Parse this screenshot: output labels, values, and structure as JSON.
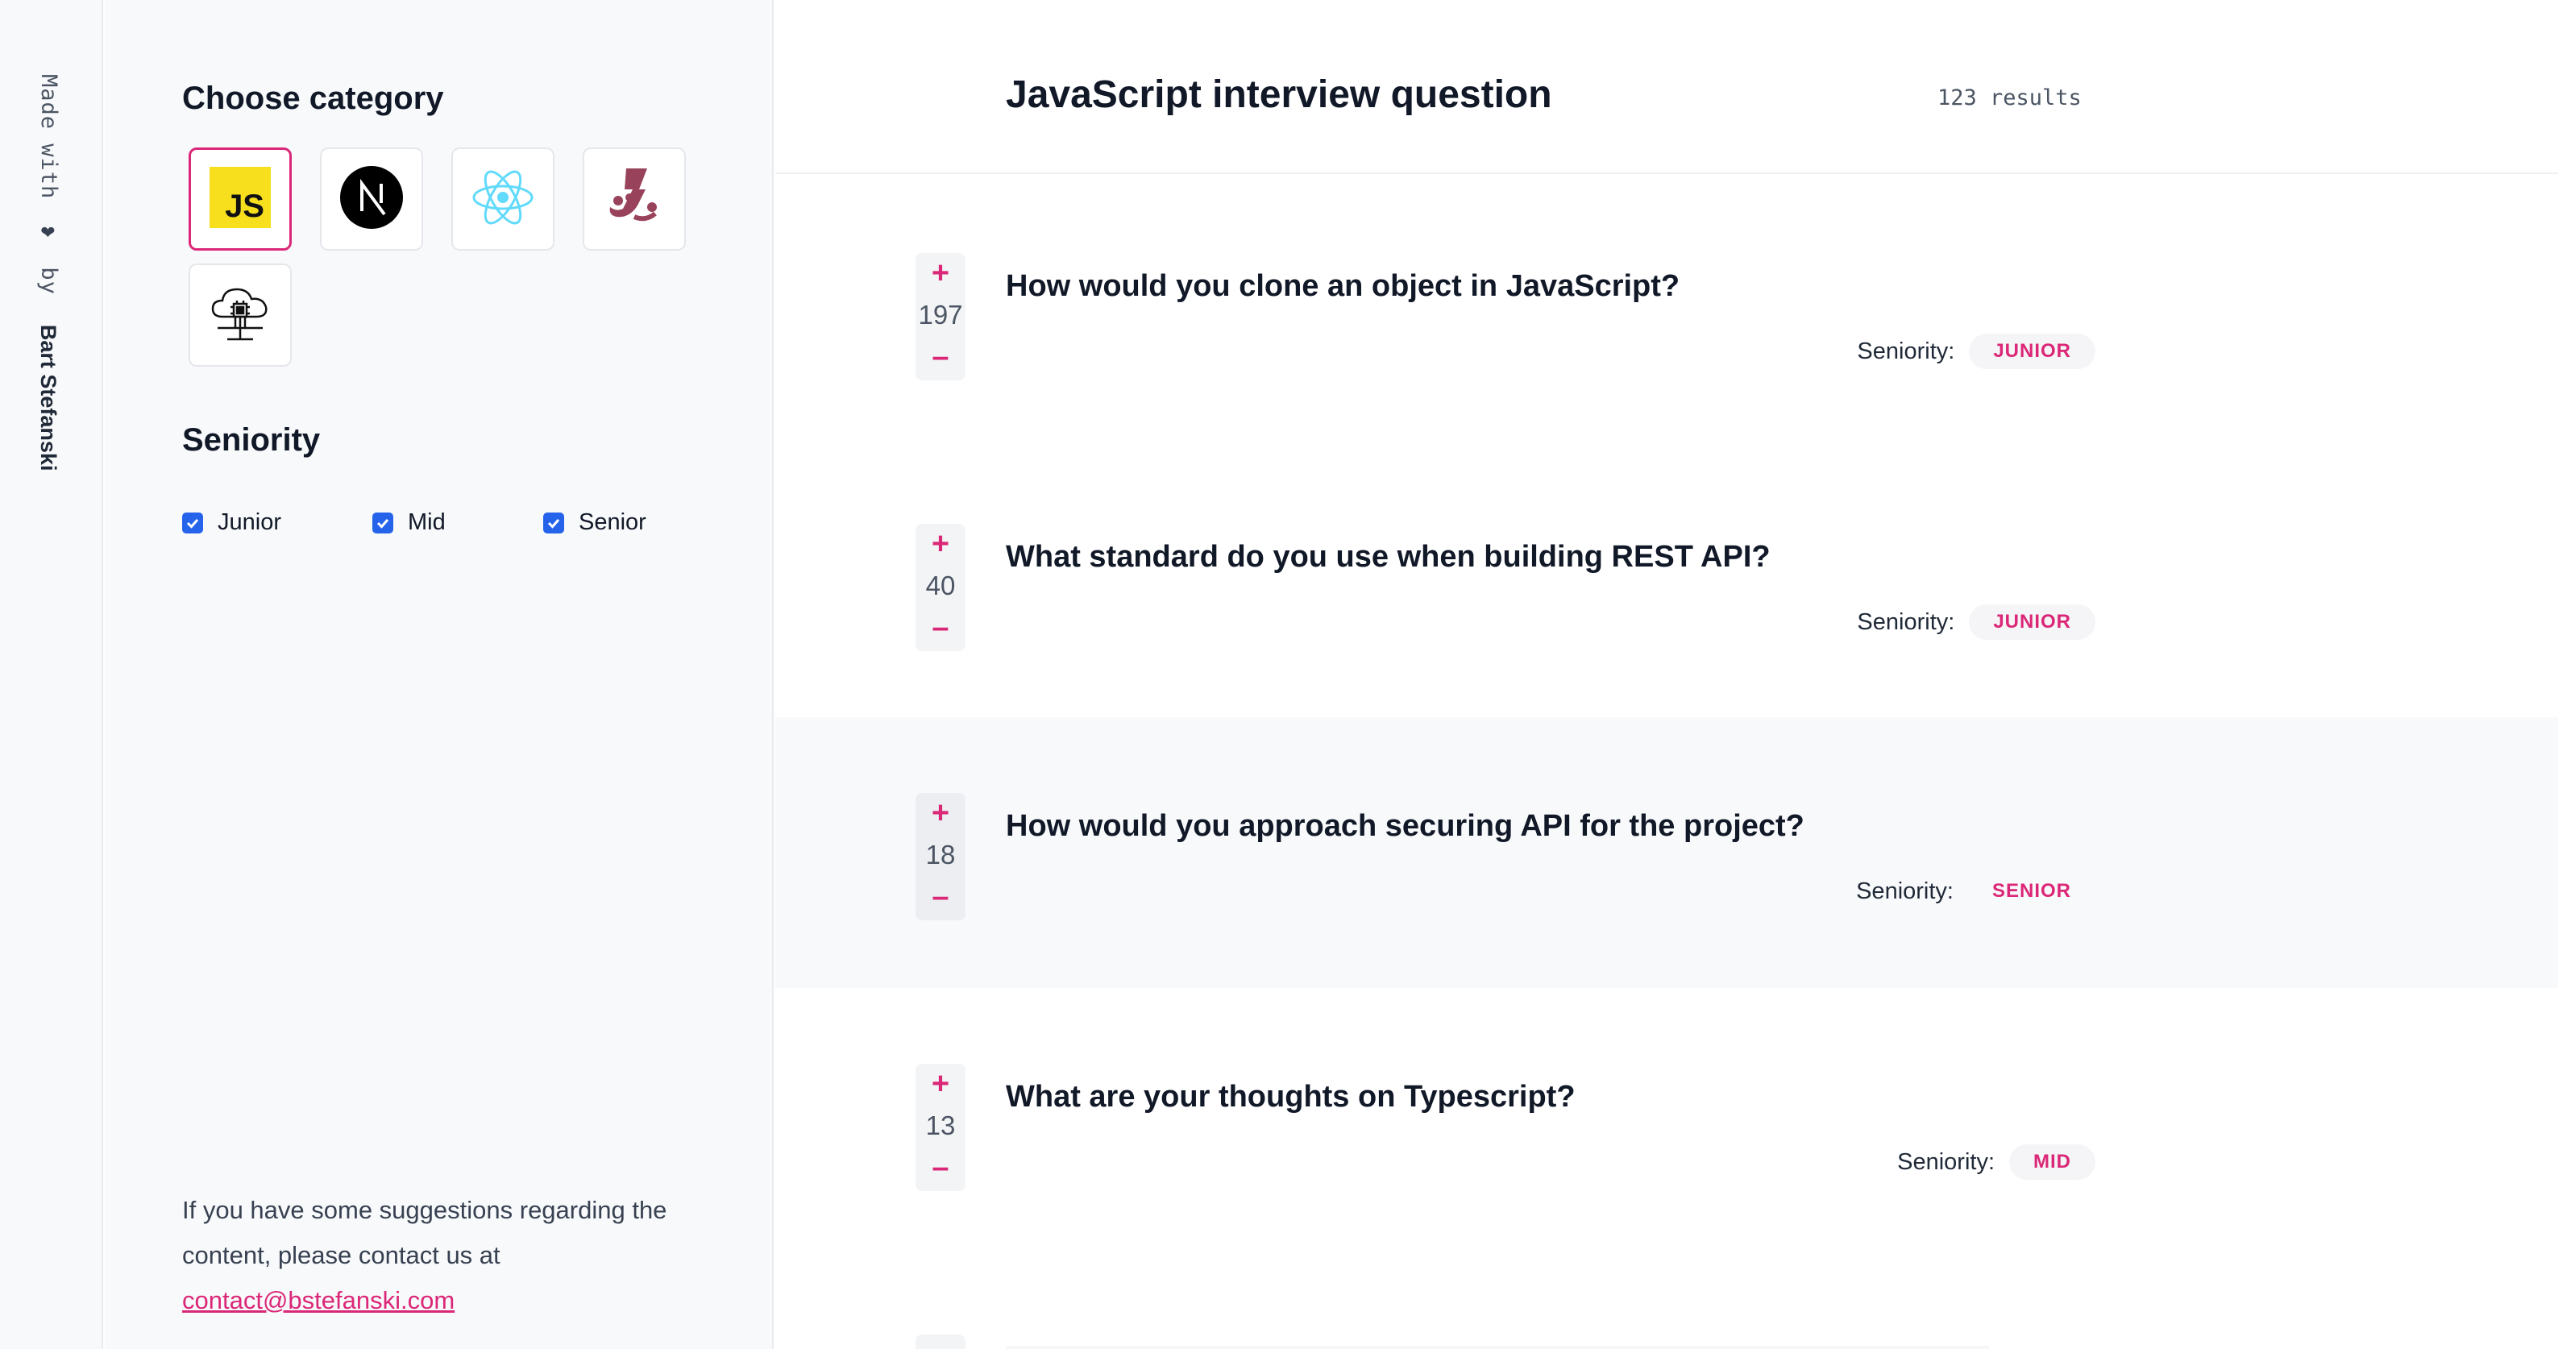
{
  "rail": {
    "made_with": "Made with",
    "by": "by",
    "author": "Bart Stefanski"
  },
  "sidebar": {
    "category_heading": "Choose category",
    "categories": [
      {
        "name": "JavaScript",
        "icon": "javascript-icon",
        "active": true
      },
      {
        "name": "Next.js",
        "icon": "nextjs-icon",
        "active": false
      },
      {
        "name": "React",
        "icon": "react-icon",
        "active": false
      },
      {
        "name": "Jest",
        "icon": "jest-icon",
        "active": false
      },
      {
        "name": "Cloud",
        "icon": "cloud-chip-icon",
        "active": false
      }
    ],
    "seniority_heading": "Seniority",
    "seniority_options": [
      {
        "label": "Junior",
        "checked": true
      },
      {
        "label": "Mid",
        "checked": true
      },
      {
        "label": "Senior",
        "checked": true
      }
    ],
    "footer_text": "If you have some suggestions regarding the content, please contact us at",
    "contact_email": "contact@bstefanski.com"
  },
  "main": {
    "title": "JavaScript interview question",
    "results": "123 results",
    "seniority_label": "Seniority:",
    "questions": [
      {
        "votes": "197",
        "title": "How would you clone an object in JavaScript?",
        "seniority": "JUNIOR"
      },
      {
        "votes": "40",
        "title": "What standard do you use when building REST API?",
        "seniority": "JUNIOR"
      },
      {
        "votes": "18",
        "title": "How would you approach securing API for the project?",
        "seniority": "SENIOR"
      },
      {
        "votes": "13",
        "title": "What are your thoughts on Typescript?",
        "seniority": "MID"
      }
    ]
  },
  "colors": {
    "accent": "#db2777",
    "checkbox": "#2563eb",
    "sidebar_bg": "#f8f9fb"
  }
}
